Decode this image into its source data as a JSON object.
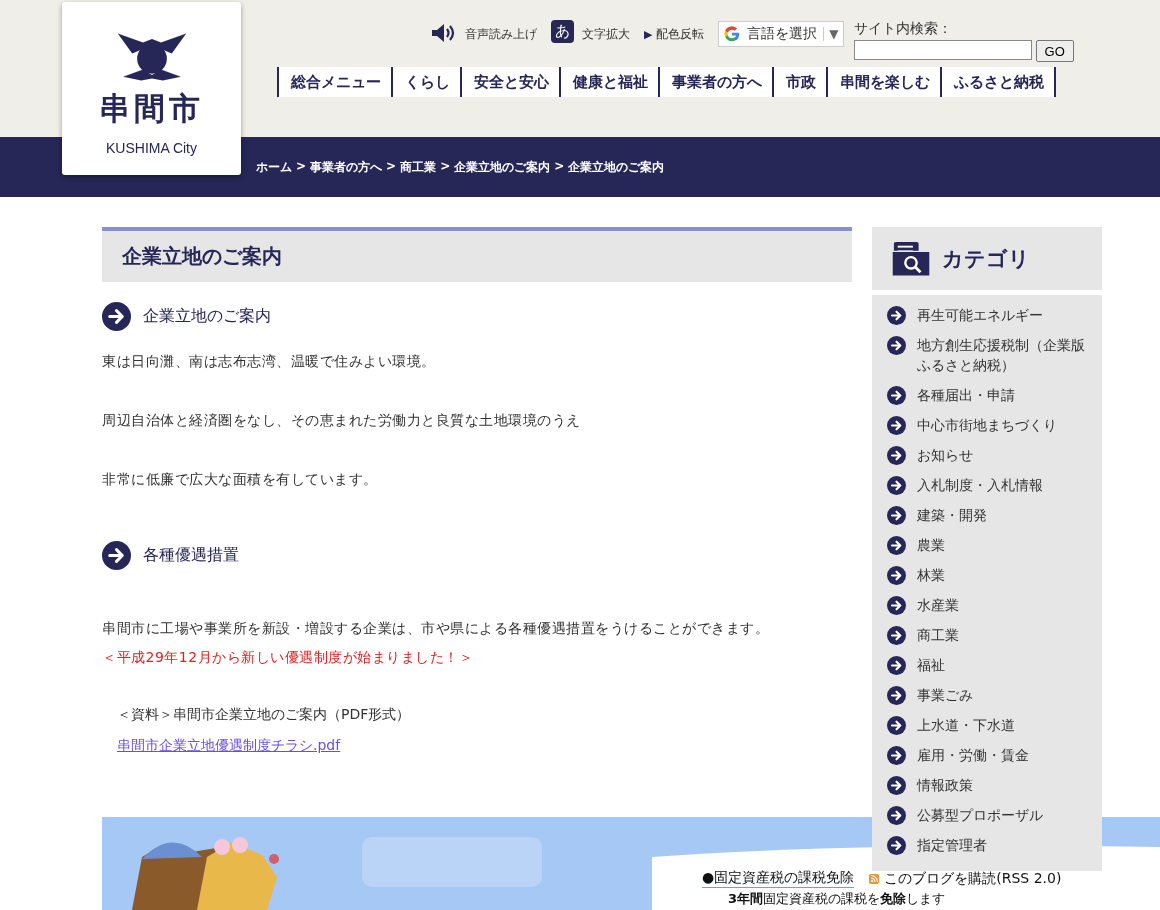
{
  "header": {
    "logo": {
      "name": "串間市",
      "roman": "KUSHIMA City"
    },
    "tools": [
      {
        "kind": "speech",
        "label": "音声読み上げ"
      },
      {
        "kind": "text-size",
        "badge": "あ",
        "label": "文字拡大"
      },
      {
        "kind": "contrast",
        "marker": "▶",
        "label": "配色反転"
      }
    ],
    "translate": {
      "label": "言語を選択",
      "caret": "▼"
    },
    "search": {
      "label": "サイト内検索：",
      "button": "GO"
    },
    "nav": [
      "総合メニュー",
      "くらし",
      "安全と安心",
      "健康と福祉",
      "事業者の方へ",
      "市政",
      "串間を楽しむ",
      "ふるさと納税"
    ]
  },
  "breadcrumb": {
    "separator": ">",
    "items": [
      "ホーム",
      "事業者の方へ",
      "商工業",
      "企業立地のご案内",
      "企業立地のご案内"
    ]
  },
  "main": {
    "title": "企業立地のご案内",
    "blocks": [
      {
        "kind": "heading",
        "text": "企業立地のご案内"
      },
      {
        "kind": "paragraph",
        "text": "東は日向灘、南は志布志湾、温暖で住みよい環境。"
      },
      {
        "kind": "paragraph",
        "text": "周辺自治体と経済圏をなし、その恵まれた労働力と良質な土地環境のうえ"
      },
      {
        "kind": "paragraph",
        "text": "非常に低廉で広大な面積を有しています。"
      },
      {
        "kind": "heading",
        "text": "各種優遇措置"
      },
      {
        "kind": "paragraph",
        "text": "串間市に工場や事業所を新設・増設する企業は、市や県による各種優遇措置をうけることができます。"
      },
      {
        "kind": "notice",
        "text": "＜平成29年12月から新しい優遇制度が始まりました！＞"
      },
      {
        "kind": "note",
        "text": "＜資料＞串間市企業立地のご案内（PDF形式）"
      },
      {
        "kind": "link",
        "text": "串間市企業立地優遇制度チラシ.pdf"
      }
    ]
  },
  "sidebar": {
    "title": "カテゴリ",
    "items": [
      "再生可能エネルギー",
      "地方創生応援税制（企業版ふるさと納税）",
      "各種届出・申請",
      "中心市街地まちづくり",
      "お知らせ",
      "入札制度・入札情報",
      "建築・開発",
      "農業",
      "林業",
      "水産業",
      "商工業",
      "福祉",
      "事業ごみ",
      "上水道・下水道",
      "雇用・労働・賃金",
      "情報政策",
      "公募型プロポーザル",
      "指定管理者"
    ]
  },
  "banner": {
    "kind": "picture",
    "lines": [
      {
        "kind": "bullet",
        "text": "●固定資産税の課税免除"
      },
      {
        "kind": "body",
        "text": "**3年間**固定資産税の課税を**免除**します"
      }
    ],
    "rss": "このブログを購読(RSS 2.0)"
  }
}
